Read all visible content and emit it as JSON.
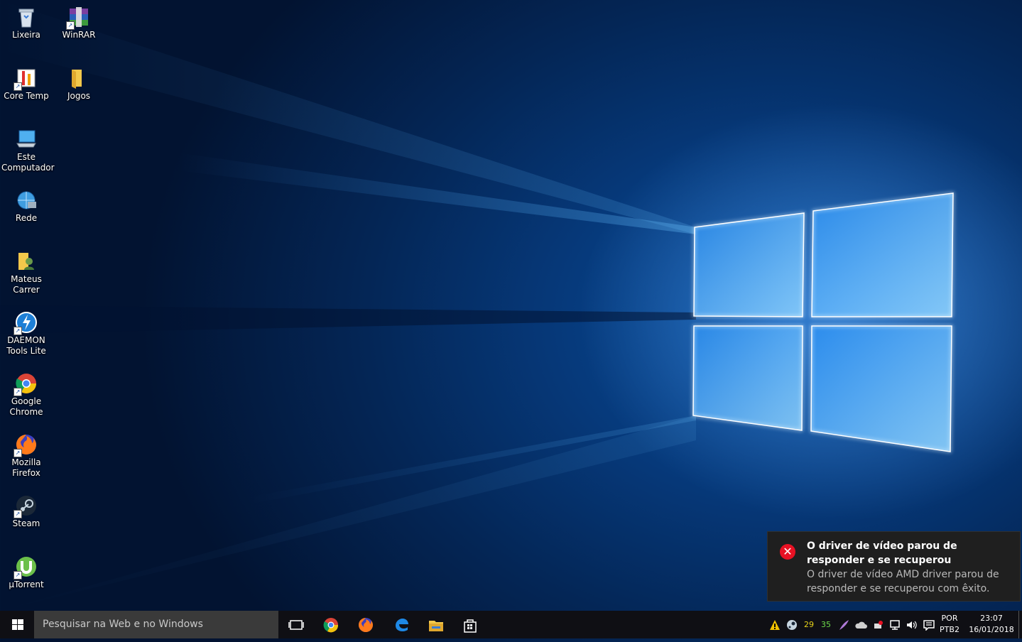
{
  "desktop": {
    "icons": [
      {
        "label": "Lixeira",
        "icon": "recycle-bin-icon"
      },
      {
        "label": "WinRAR",
        "icon": "winrar-icon"
      },
      {
        "label": "Core Temp",
        "icon": "core-temp-icon"
      },
      {
        "label": "Jogos",
        "icon": "folder-icon"
      },
      {
        "label": "Este Computador",
        "icon": "computer-icon"
      },
      {
        "label": "Rede",
        "icon": "network-icon"
      },
      {
        "label": "Mateus Carrer",
        "icon": "user-folder-icon"
      },
      {
        "label": "DAEMON Tools Lite",
        "icon": "daemon-tools-icon"
      },
      {
        "label": "Google Chrome",
        "icon": "chrome-icon"
      },
      {
        "label": "Mozilla Firefox",
        "icon": "firefox-icon"
      },
      {
        "label": "Steam",
        "icon": "steam-icon"
      },
      {
        "label": "µTorrent",
        "icon": "utorrent-icon"
      }
    ]
  },
  "toast": {
    "title": "O driver de vídeo parou de responder e se recuperou",
    "body": "O driver de vídeo AMD driver parou de responder e se recuperou com êxito.",
    "icon": "error-icon"
  },
  "taskbar": {
    "search_placeholder": "Pesquisar na Web e no Windows",
    "pinned": [
      "task-view-icon",
      "chrome-icon",
      "firefox-icon",
      "edge-icon",
      "file-explorer-icon",
      "store-icon"
    ],
    "tray": {
      "temp1": "29",
      "temp2": "35",
      "lang_top": "POR",
      "lang_bottom": "PTB2",
      "time": "23:07",
      "date": "16/01/2018"
    }
  },
  "colors": {
    "accent": "#0078d7",
    "error": "#e81123",
    "temp1": "#e8d31a",
    "temp2": "#6ddc4a"
  }
}
